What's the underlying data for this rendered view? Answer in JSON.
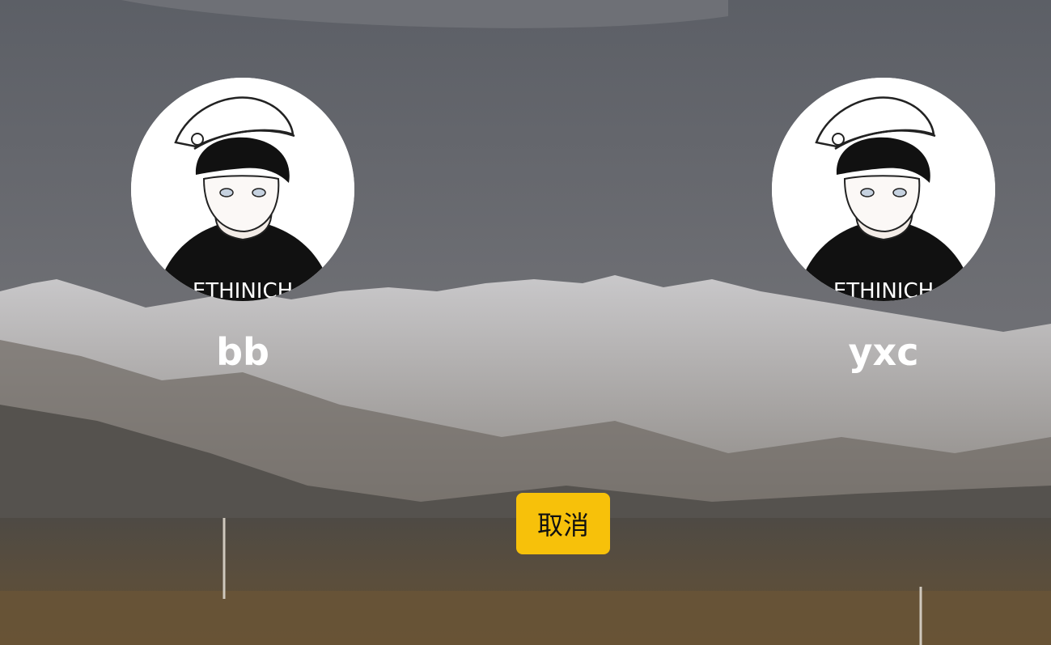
{
  "users": [
    {
      "name": "bb",
      "avatar_icon": "anime-boy-cap-avatar",
      "shirt_text": "ETHINICH"
    },
    {
      "name": "yxc",
      "avatar_icon": "anime-boy-cap-avatar",
      "shirt_text": "ETHINICH"
    }
  ],
  "cancel_label": "取消",
  "colors": {
    "accent": "#f7c10a",
    "text": "#ffffff"
  }
}
